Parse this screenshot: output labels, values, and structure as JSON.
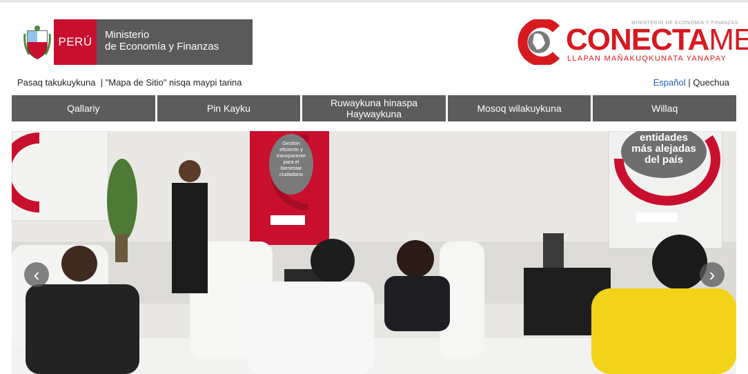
{
  "header": {
    "peru_label": "PERÚ",
    "ministry_line1": "Ministerio",
    "ministry_line2": "de Economía y Finanzas",
    "conecta_top": "MINISTERIO DE ECONOMÍA Y FINANZAS",
    "conecta_name_a": "CONECTA",
    "conecta_name_b": "MEF",
    "conecta_tagline": "LLAPAN MAÑAKUQKUNATA YANAPAY"
  },
  "utility": {
    "link1": "Pasaq takukuykuna",
    "separator": "  | ",
    "link2": "\"Mapa de Sitio\" nisqa maypi tarina"
  },
  "language": {
    "spanish": "Español",
    "sep": " | ",
    "quechua": "Quechua"
  },
  "nav": {
    "items": [
      {
        "label": "Qallariy"
      },
      {
        "label": "Pin Kayku"
      },
      {
        "label": "Ruwaykuna hinaspa Haywaykuna"
      },
      {
        "label": "Mosoq wilakuykuna"
      },
      {
        "label": "Willaq"
      }
    ]
  },
  "hero": {
    "poster1_text": "Gestión eficiente y transparente para el bienestar ciudadano",
    "poster2_text": "entidades más alejadas del país",
    "prev_icon": "chevron-left-icon",
    "next_icon": "chevron-right-icon"
  },
  "colors": {
    "brand_red": "#c8102e",
    "nav_gray": "#5c5c5c",
    "ministry_gray": "#5a5a5a"
  }
}
